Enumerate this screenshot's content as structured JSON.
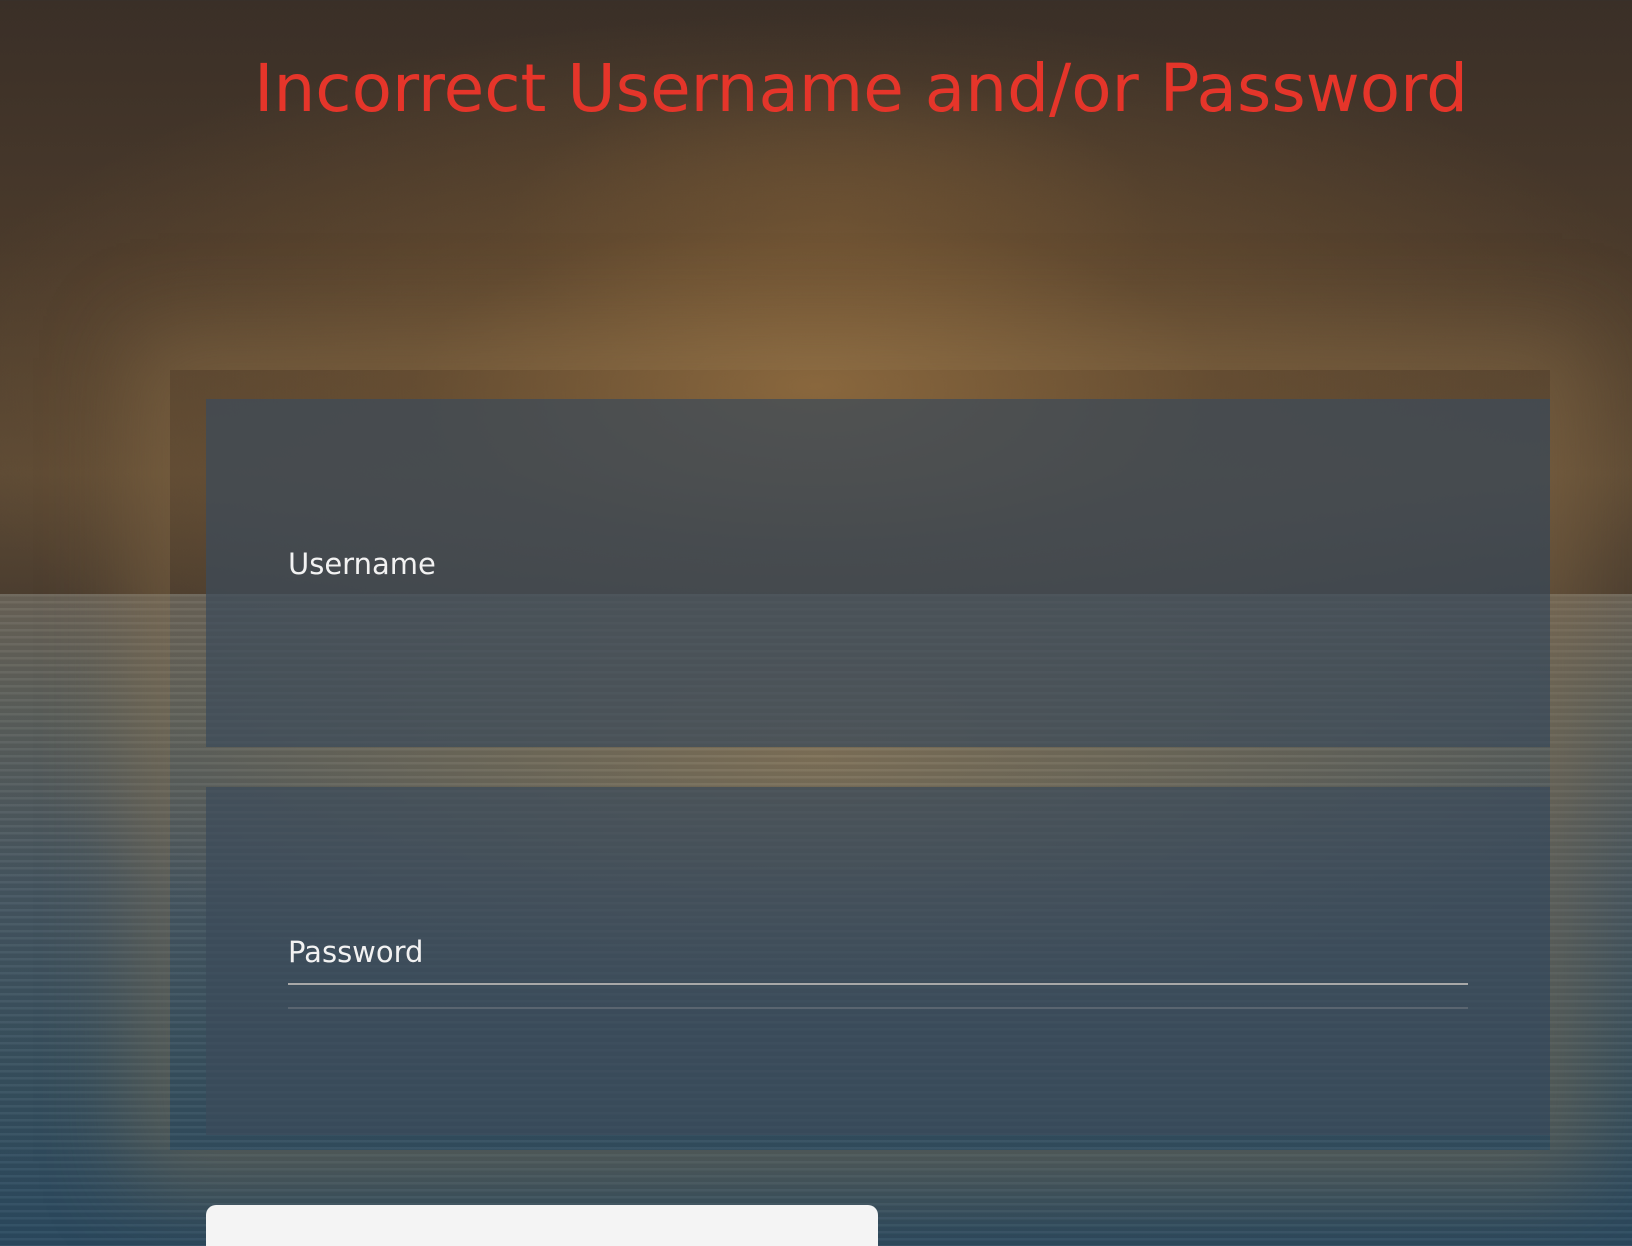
{
  "error": {
    "message": "Incorrect Username and/or Password",
    "color": "#e5352a"
  },
  "form": {
    "username": {
      "label": "Username",
      "value": ""
    },
    "password": {
      "label": "Password",
      "value": ""
    },
    "submit_label": ""
  }
}
